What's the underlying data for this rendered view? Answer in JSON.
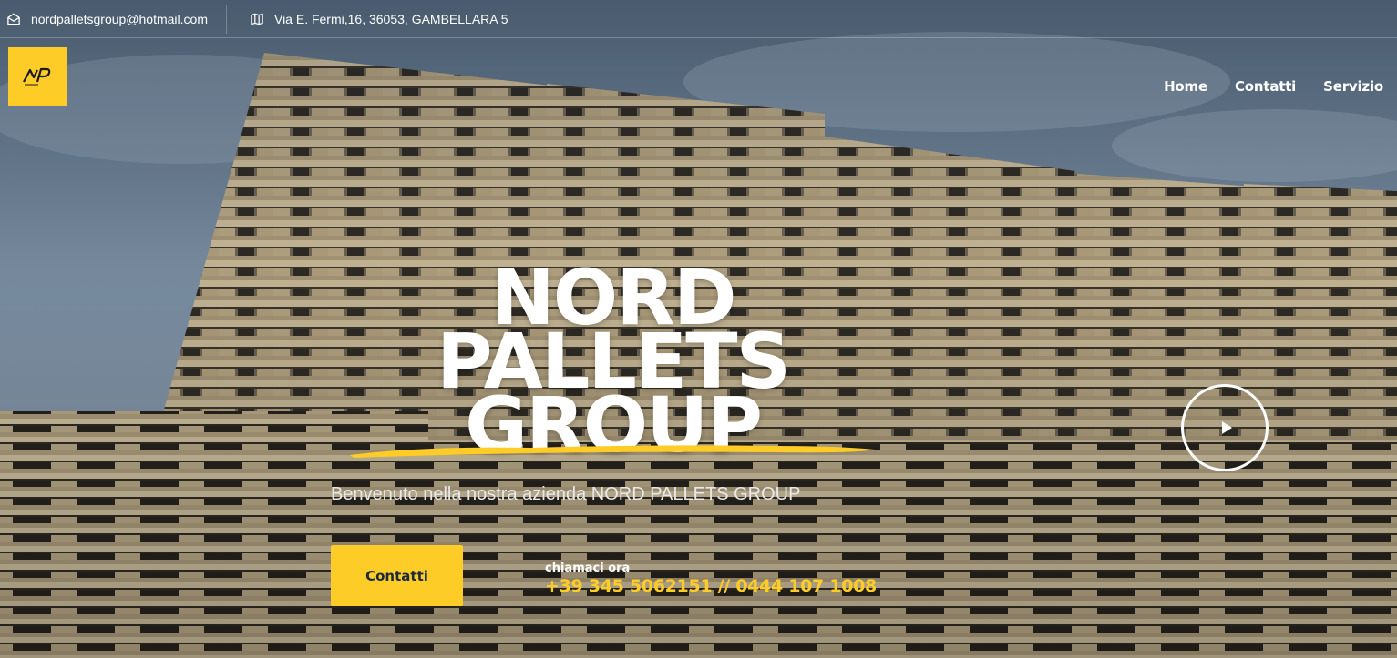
{
  "topbar": {
    "email": "nordpalletsgroup@hotmail.com",
    "address": "Via E. Fermi,16, 36053, GAMBELLARA 5"
  },
  "header": {
    "logo_icon": "np-logo-icon",
    "nav": [
      {
        "label": "Home"
      },
      {
        "label": "Contatti"
      },
      {
        "label": "Servizio"
      }
    ]
  },
  "hero": {
    "title_lines": [
      "NORD",
      "PALLETS",
      "GROUP"
    ],
    "subtitle": "Benvenuto nella nostra azienda NORD PALLETS GROUP",
    "cta_label": "Contatti",
    "call_label": "chiamaci ora",
    "phone": "+39 345 5062151 // 0444 107 1008",
    "play_icon": "play-icon"
  },
  "colors": {
    "accent": "#fecc27",
    "text": "#ffffff",
    "button_text": "#1c2a3a"
  }
}
